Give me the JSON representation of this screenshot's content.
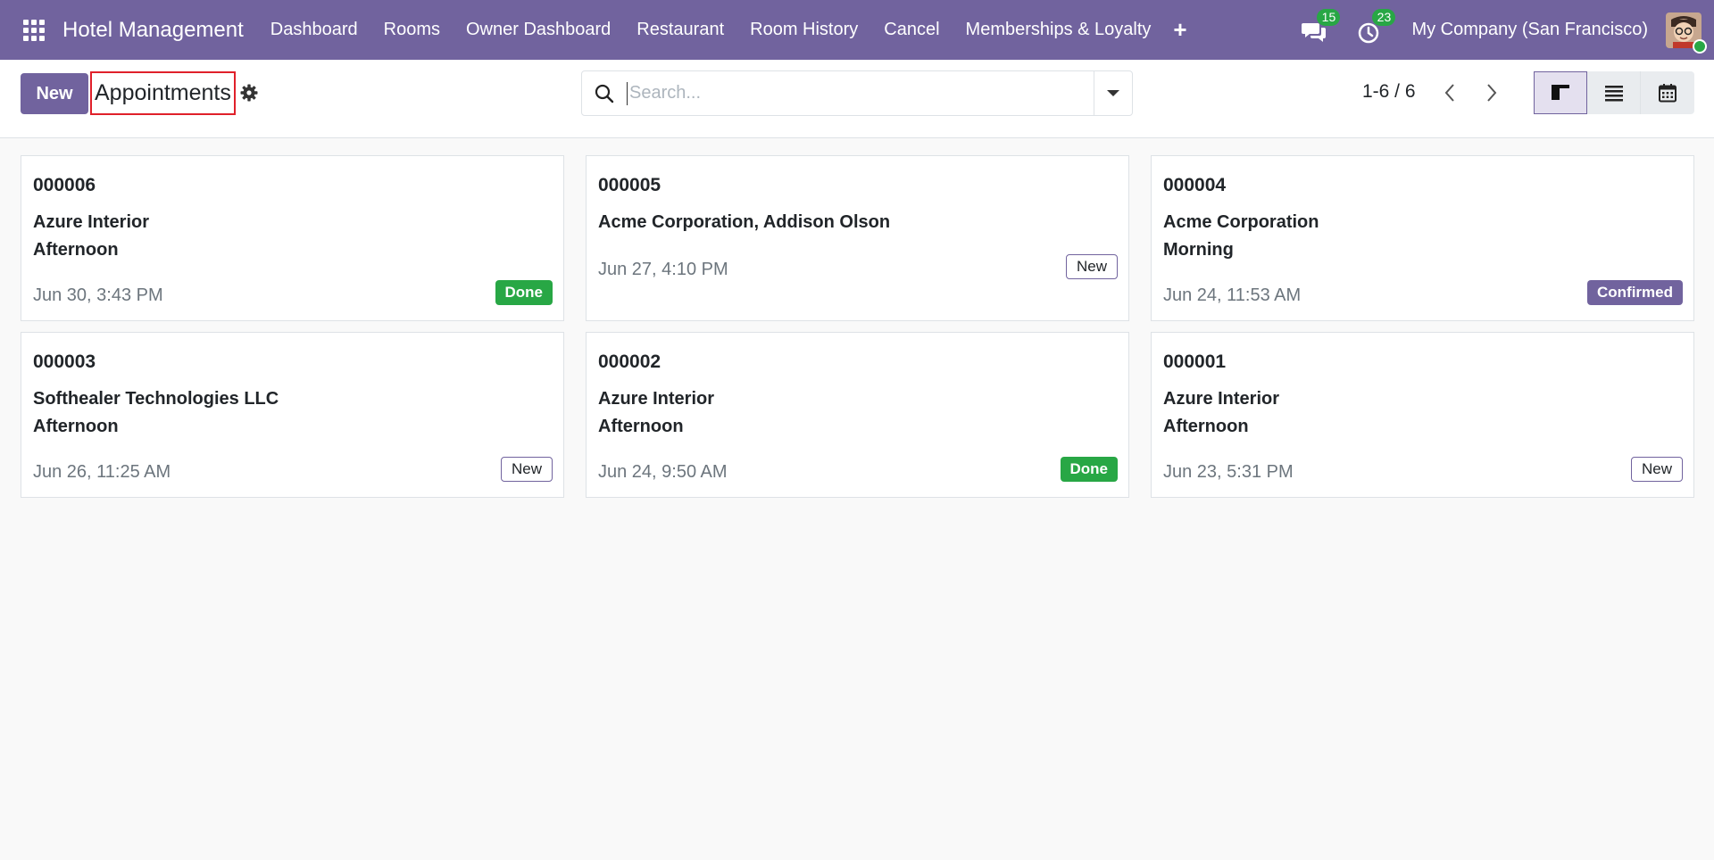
{
  "navbar": {
    "brand": "Hotel Management",
    "menu": [
      "Dashboard",
      "Rooms",
      "Owner Dashboard",
      "Restaurant",
      "Room History",
      "Cancel",
      "Memberships & Loyalty"
    ],
    "plus_icon": "plus-icon",
    "messages_count": "15",
    "activities_count": "23",
    "company": "My Company (San Francisco)",
    "colors": {
      "primary": "#71639e",
      "badge": "#28a745"
    }
  },
  "control": {
    "new_label": "New",
    "title": "Appointments",
    "search_placeholder": "Search...",
    "pager": "1-6 / 6"
  },
  "cards": [
    {
      "ref": "000006",
      "partner": "Azure Interior",
      "slot": "Afternoon",
      "date": "Jun 30, 3:43 PM",
      "status": "Done"
    },
    {
      "ref": "000005",
      "partner": "Acme Corporation, Addison Olson",
      "slot": "",
      "date": "Jun 27, 4:10 PM",
      "status": "New"
    },
    {
      "ref": "000004",
      "partner": "Acme Corporation",
      "slot": "Morning",
      "date": "Jun 24, 11:53 AM",
      "status": "Confirmed"
    },
    {
      "ref": "000003",
      "partner": "Softhealer Technologies LLC",
      "slot": "Afternoon",
      "date": "Jun 26, 11:25 AM",
      "status": "New"
    },
    {
      "ref": "000002",
      "partner": "Azure Interior",
      "slot": "Afternoon",
      "date": "Jun 24, 9:50 AM",
      "status": "Done"
    },
    {
      "ref": "000001",
      "partner": "Azure Interior",
      "slot": "Afternoon",
      "date": "Jun 23, 5:31 PM",
      "status": "New"
    }
  ]
}
